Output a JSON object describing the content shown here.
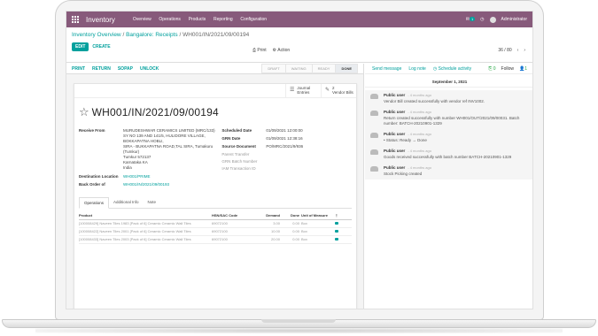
{
  "navbar": {
    "app_title": "Inventory",
    "menu": [
      "Overview",
      "Operations",
      "Products",
      "Reporting",
      "Configuration"
    ],
    "notification_count": "1",
    "user": "Administrator"
  },
  "control": {
    "breadcrumb_1": "Inventory Overview",
    "breadcrumb_2": "Bangalore: Receipts",
    "breadcrumb_current": "WH001/IN/2021/09/00194",
    "edit_label": "EDIT",
    "create_label": "CREATE",
    "print_label": "Print",
    "action_label": "Action",
    "pager": "36 / 80"
  },
  "statusbar": {
    "buttons": [
      "PRINT",
      "RETURN",
      "SOPAP",
      "UNLOCK"
    ],
    "stages": [
      "DRAFT",
      "WAITING",
      "READY",
      "DONE"
    ]
  },
  "sheet": {
    "journal_entries": "Journal Entries",
    "vendor_bills_count": "2",
    "vendor_bills_label": "Vendor Bills",
    "title": "WH001/IN/2021/09/00194",
    "receive_from_label": "Receive From",
    "receive_from_lines": [
      "MURUDESHWAR CERAMICS LIMITED (MRC/133)",
      "SY NO 139 AND 141/5, HULIDORE VILLAGE,",
      "BOKKAPATNA HOBLI,",
      "SIRA - BUKKAPATNA ROAD,TAL SIRA, Tumakuru",
      "(Tumkur)",
      "Tumkur 572137",
      "Karnataka KA",
      "India"
    ],
    "destination_label": "Destination Location",
    "destination_value": "WH001/PRIME",
    "backorder_label": "Back Order of",
    "backorder_value": "WH001/IN/2021/09/00193",
    "scheduled_label": "Scheduled Date",
    "scheduled_value": "01/09/2021 12:00:00",
    "grn_label": "GRN Date",
    "grn_value": "01/09/2021 12:38:16",
    "source_label": "Source Document",
    "source_value": "PO/MRC/2021/9/936",
    "parent_label": "Parent Transfer",
    "grn_batch_label": "GRN Batch Number",
    "iam_label": "IAM Transaction ID"
  },
  "tabs": [
    "Operations",
    "Additional Info",
    "Note"
  ],
  "ops": {
    "headers": [
      "Product",
      "HSN/SAC Code",
      "Demand",
      "Done",
      "Unit of Measure"
    ],
    "rows": [
      {
        "product": "[100008429] Naveen Tiles 1983 [Pack of 6] Ceramic Ceramic Wall Tiles",
        "hsn": "69072100",
        "demand": "3.00",
        "done": "0.00",
        "uom": "Box"
      },
      {
        "product": "[100008422] Naveen Tiles 2001 [Pack of 6] Ceramic Ceramic Wall Tiles",
        "hsn": "69072100",
        "demand": "10.00",
        "done": "0.00",
        "uom": "Box"
      },
      {
        "product": "[100008433] Naveen Tiles 2003 [Pack of 6] Ceramic Ceramic Wall Tiles",
        "hsn": "69072100",
        "demand": "20.00",
        "done": "0.00",
        "uom": "Box"
      }
    ]
  },
  "chatter": {
    "send_message": "Send message",
    "log_note": "Log note",
    "schedule_activity": "Schedule activity",
    "attachments": "0",
    "follow": "Follow",
    "followers": "1",
    "date": "September 1, 2021",
    "messages": [
      {
        "author": "Public user",
        "time": "- 4 months ago",
        "text": "Vendor Bill created successfully with vendor ref INV1002."
      },
      {
        "author": "Public user",
        "time": "- 4 months ago",
        "text": "Return created successfully with number WH001/OUT/2021/09/00031. Batch number: BATCH-20210901-1329"
      },
      {
        "author": "Public user",
        "time": "- 4 months ago",
        "text": "Status: Ready → Done"
      },
      {
        "author": "Public user",
        "time": "- 4 months ago",
        "text": "Goods received successfully with batch number BATCH-20210901-1329"
      },
      {
        "author": "Public user",
        "time": "- 4 months ago",
        "text": "Stock Picking created"
      }
    ]
  }
}
